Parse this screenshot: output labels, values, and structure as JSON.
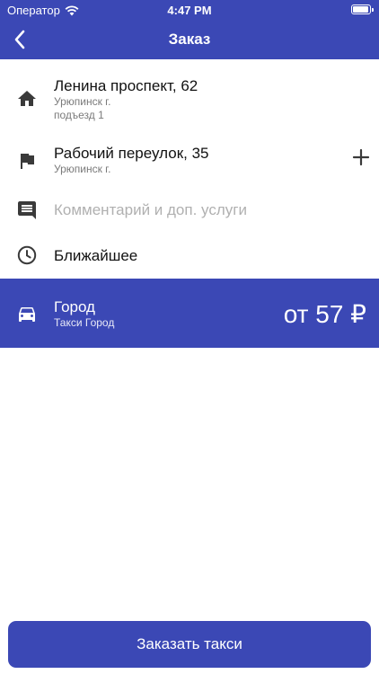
{
  "status_bar": {
    "carrier": "Оператор",
    "time": "4:47 PM"
  },
  "nav": {
    "title": "Заказ"
  },
  "route": {
    "from": {
      "address": "Ленина проспект, 62",
      "city": "Урюпинск г.",
      "entrance": "подъезд 1"
    },
    "to": {
      "address": "Рабочий переулок, 35",
      "city": "Урюпинск г."
    }
  },
  "comment": {
    "placeholder": "Комментарий и доп. услуги"
  },
  "time_option": {
    "label": "Ближайшее"
  },
  "tariff": {
    "name": "Город",
    "subtitle": "Такси Город",
    "price": "от 57 ₽"
  },
  "order_button": {
    "label": "Заказать такси"
  },
  "colors": {
    "accent": "#3b48b5",
    "icon": "#3a3a3a",
    "placeholder": "#b0b0b0",
    "secondary_text": "#7a7a7a"
  },
  "icons": {
    "from": "home-icon",
    "to": "flag-icon",
    "comment": "comment-icon",
    "time": "clock-icon",
    "tariff": "car-icon",
    "add": "plus-icon",
    "back": "chevron-left-icon"
  }
}
